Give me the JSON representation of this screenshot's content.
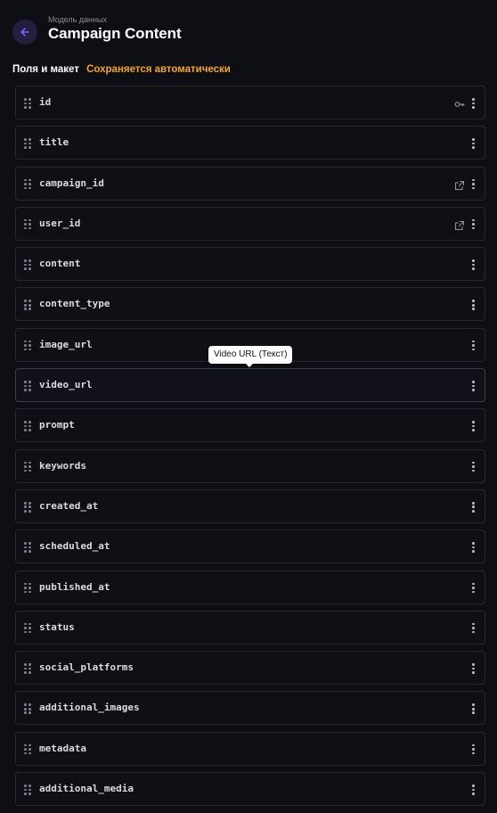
{
  "header": {
    "overline": "Модель данных",
    "title": "Campaign Content",
    "back_icon": "arrow-left-icon",
    "accent_color": "#7b61ff"
  },
  "section": {
    "label": "Поля и макет",
    "status": "Сохраняется автоматически",
    "status_color": "#f5a623"
  },
  "fields": [
    {
      "name": "id",
      "aux_icon": "key-icon"
    },
    {
      "name": "title",
      "aux_icon": ""
    },
    {
      "name": "campaign_id",
      "aux_icon": "external-link-icon"
    },
    {
      "name": "user_id",
      "aux_icon": "external-link-icon"
    },
    {
      "name": "content",
      "aux_icon": ""
    },
    {
      "name": "content_type",
      "aux_icon": ""
    },
    {
      "name": "image_url",
      "aux_icon": ""
    },
    {
      "name": "video_url",
      "aux_icon": ""
    },
    {
      "name": "prompt",
      "aux_icon": ""
    },
    {
      "name": "keywords",
      "aux_icon": ""
    },
    {
      "name": "created_at",
      "aux_icon": ""
    },
    {
      "name": "scheduled_at",
      "aux_icon": ""
    },
    {
      "name": "published_at",
      "aux_icon": ""
    },
    {
      "name": "status",
      "aux_icon": ""
    },
    {
      "name": "social_platforms",
      "aux_icon": ""
    },
    {
      "name": "additional_images",
      "aux_icon": ""
    },
    {
      "name": "metadata",
      "aux_icon": ""
    },
    {
      "name": "additional_media",
      "aux_icon": ""
    }
  ],
  "tooltip": {
    "text": "Video URL (Текст)"
  }
}
